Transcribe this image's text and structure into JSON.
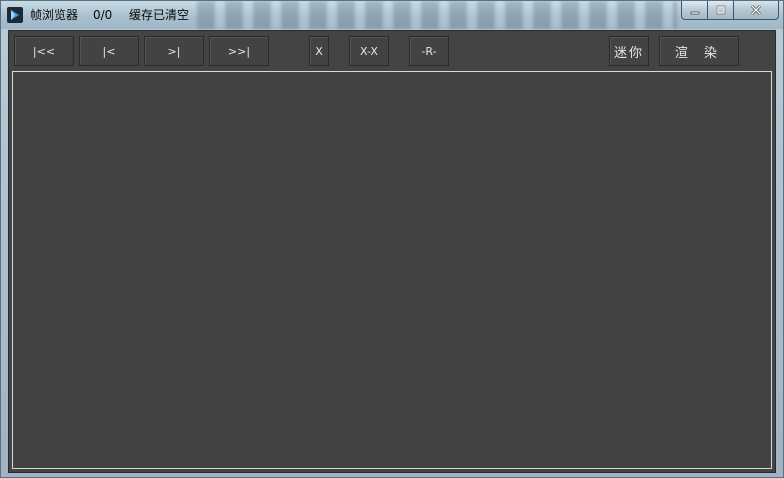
{
  "titlebar": {
    "title": "帧浏览器",
    "frame_count": "0/0",
    "status": "缓存已清空"
  },
  "window_controls": {
    "minimize": "▁",
    "maximize": "□",
    "close": "✕"
  },
  "toolbar": {
    "first": "|<<",
    "prev": "|<",
    "next": ">|",
    "last": ">>|",
    "x": "X",
    "x_x": "X-X",
    "r": "-R-",
    "mini": "迷你",
    "render": "渲 染"
  },
  "colors": {
    "panel_bg": "#444444",
    "viewport_border": "#d9d9d9",
    "button_text": "#e6e6e6"
  }
}
